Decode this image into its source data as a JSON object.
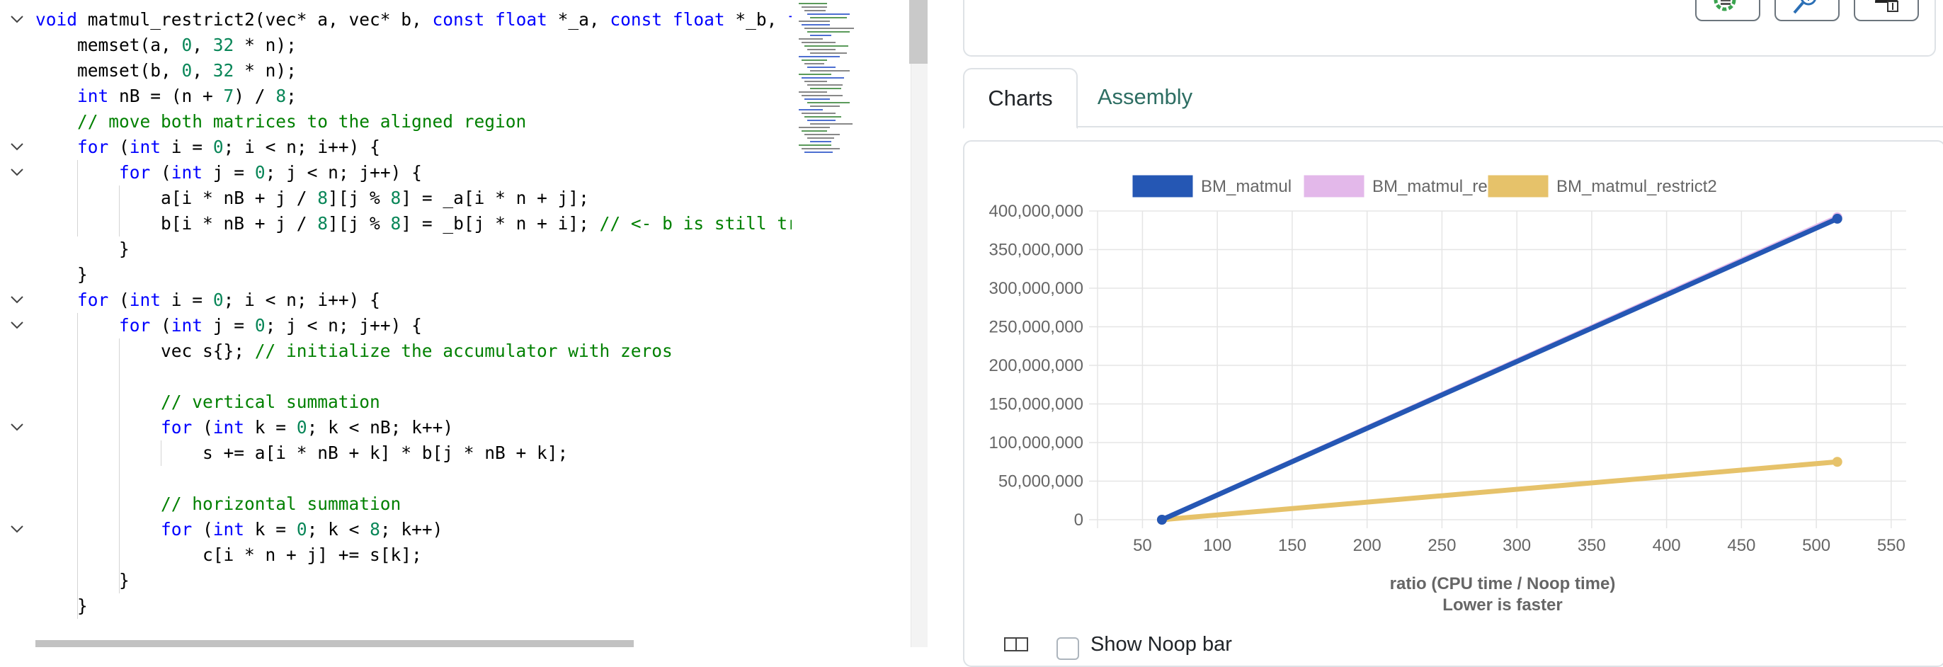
{
  "editor": {
    "code": [
      {
        "fold": true,
        "indent": 0,
        "tokens": [
          [
            "kw",
            "void"
          ],
          [
            "t",
            " matmul_restrict2(vec* a, vec* b, "
          ],
          [
            "kw",
            "const"
          ],
          [
            "t",
            " "
          ],
          [
            "kw",
            "float"
          ],
          [
            "t",
            " *_a, "
          ],
          [
            "kw",
            "const"
          ],
          [
            "t",
            " "
          ],
          [
            "kw",
            "float"
          ],
          [
            "t",
            " *_b, "
          ],
          [
            "kw",
            "fl"
          ]
        ]
      },
      {
        "fold": false,
        "indent": 1,
        "tokens": [
          [
            "t",
            "memset(a, "
          ],
          [
            "num",
            "0"
          ],
          [
            "t",
            ", "
          ],
          [
            "num",
            "32"
          ],
          [
            "t",
            " * n);"
          ]
        ]
      },
      {
        "fold": false,
        "indent": 1,
        "tokens": [
          [
            "t",
            "memset(b, "
          ],
          [
            "num",
            "0"
          ],
          [
            "t",
            ", "
          ],
          [
            "num",
            "32"
          ],
          [
            "t",
            " * n);"
          ]
        ]
      },
      {
        "fold": false,
        "indent": 1,
        "tokens": [
          [
            "kw",
            "int"
          ],
          [
            "t",
            " nB = (n + "
          ],
          [
            "num",
            "7"
          ],
          [
            "t",
            ") / "
          ],
          [
            "num",
            "8"
          ],
          [
            "t",
            ";"
          ]
        ]
      },
      {
        "fold": false,
        "indent": 1,
        "tokens": [
          [
            "cm",
            "// move both matrices to the aligned region"
          ]
        ]
      },
      {
        "fold": true,
        "indent": 1,
        "tokens": [
          [
            "kw",
            "for"
          ],
          [
            "t",
            " ("
          ],
          [
            "kw",
            "int"
          ],
          [
            "t",
            " i = "
          ],
          [
            "num",
            "0"
          ],
          [
            "t",
            "; i < n; i++) {"
          ]
        ]
      },
      {
        "fold": true,
        "indent": 2,
        "tokens": [
          [
            "kw",
            "for"
          ],
          [
            "t",
            " ("
          ],
          [
            "kw",
            "int"
          ],
          [
            "t",
            " j = "
          ],
          [
            "num",
            "0"
          ],
          [
            "t",
            "; j < n; j++) {"
          ]
        ]
      },
      {
        "fold": false,
        "indent": 3,
        "tokens": [
          [
            "t",
            "a[i * nB + j / "
          ],
          [
            "num",
            "8"
          ],
          [
            "t",
            "][j % "
          ],
          [
            "num",
            "8"
          ],
          [
            "t",
            "] = _a[i * n + j];"
          ]
        ]
      },
      {
        "fold": false,
        "indent": 3,
        "tokens": [
          [
            "t",
            "b[i * nB + j / "
          ],
          [
            "num",
            "8"
          ],
          [
            "t",
            "][j % "
          ],
          [
            "num",
            "8"
          ],
          [
            "t",
            "] = _b[j * n + i]; "
          ],
          [
            "cm",
            "// <- b is still tra"
          ]
        ]
      },
      {
        "fold": false,
        "indent": 2,
        "tokens": [
          [
            "t",
            "}"
          ]
        ]
      },
      {
        "fold": false,
        "indent": 1,
        "tokens": [
          [
            "t",
            "}"
          ]
        ]
      },
      {
        "fold": true,
        "indent": 1,
        "tokens": [
          [
            "kw",
            "for"
          ],
          [
            "t",
            " ("
          ],
          [
            "kw",
            "int"
          ],
          [
            "t",
            " i = "
          ],
          [
            "num",
            "0"
          ],
          [
            "t",
            "; i < n; i++) {"
          ]
        ]
      },
      {
        "fold": true,
        "indent": 2,
        "tokens": [
          [
            "kw",
            "for"
          ],
          [
            "t",
            " ("
          ],
          [
            "kw",
            "int"
          ],
          [
            "t",
            " j = "
          ],
          [
            "num",
            "0"
          ],
          [
            "t",
            "; j < n; j++) {"
          ]
        ]
      },
      {
        "fold": false,
        "indent": 3,
        "tokens": [
          [
            "t",
            "vec s{}; "
          ],
          [
            "cm",
            "// initialize the accumulator with zeros"
          ]
        ]
      },
      {
        "fold": false,
        "indent": 3,
        "tokens": [
          [
            "t",
            ""
          ]
        ]
      },
      {
        "fold": false,
        "indent": 3,
        "tokens": [
          [
            "cm",
            "// vertical summation"
          ]
        ]
      },
      {
        "fold": true,
        "indent": 3,
        "tokens": [
          [
            "kw",
            "for"
          ],
          [
            "t",
            " ("
          ],
          [
            "kw",
            "int"
          ],
          [
            "t",
            " k = "
          ],
          [
            "num",
            "0"
          ],
          [
            "t",
            "; k < nB; k++)"
          ]
        ]
      },
      {
        "fold": false,
        "indent": 4,
        "tokens": [
          [
            "t",
            "s += a[i * nB + k] * b[j * nB + k];"
          ]
        ]
      },
      {
        "fold": false,
        "indent": 4,
        "tokens": [
          [
            "t",
            ""
          ]
        ]
      },
      {
        "fold": false,
        "indent": 3,
        "tokens": [
          [
            "cm",
            "// horizontal summation"
          ]
        ]
      },
      {
        "fold": true,
        "indent": 3,
        "tokens": [
          [
            "kw",
            "for"
          ],
          [
            "t",
            " ("
          ],
          [
            "kw",
            "int"
          ],
          [
            "t",
            " k = "
          ],
          [
            "num",
            "0"
          ],
          [
            "t",
            "; k < "
          ],
          [
            "num",
            "8"
          ],
          [
            "t",
            "; k++)"
          ]
        ]
      },
      {
        "fold": false,
        "indent": 4,
        "tokens": [
          [
            "t",
            "c[i * n + j] += s[k];"
          ]
        ]
      },
      {
        "fold": false,
        "indent": 2,
        "tokens": [
          [
            "t",
            "}"
          ]
        ]
      },
      {
        "fold": false,
        "indent": 1,
        "tokens": [
          [
            "t",
            "}"
          ]
        ]
      }
    ]
  },
  "toolbar": {
    "buttons": [
      {
        "icon": "gear-list-icon"
      },
      {
        "icon": "zoom-icon"
      },
      {
        "icon": "cloud-upload-icon"
      }
    ]
  },
  "tabs": [
    {
      "label": "Charts",
      "active": true
    },
    {
      "label": "Assembly",
      "active": false
    }
  ],
  "chart_data": {
    "type": "line",
    "xlabel": "ratio (CPU time / Noop time)",
    "xlabel_sub": "Lower is faster",
    "ylabel": "",
    "xlim": [
      20,
      560
    ],
    "ylim": [
      0,
      400000000
    ],
    "xticks": [
      50,
      100,
      150,
      200,
      250,
      300,
      350,
      400,
      450,
      500,
      550
    ],
    "yticks": [
      0,
      50000000,
      100000000,
      150000000,
      200000000,
      250000000,
      300000000,
      350000000,
      400000000
    ],
    "ytick_labels": [
      "0",
      "50,000,000",
      "100,000,000",
      "150,000,000",
      "200,000,000",
      "250,000,000",
      "300,000,000",
      "350,000,000",
      "400,000,000"
    ],
    "xtick_labels": [
      "50",
      "100",
      "150",
      "200",
      "250",
      "300",
      "350",
      "400",
      "450",
      "500",
      "550"
    ],
    "grid": true,
    "legend_position": "top",
    "series": [
      {
        "name": "BM_matmul",
        "color": "#2557b4",
        "points": [
          [
            63,
            0
          ],
          [
            514,
            390000000
          ]
        ]
      },
      {
        "name": "BM_matmul_restrict",
        "color": "#e3b8ea",
        "points": [
          [
            63,
            0
          ],
          [
            514,
            392000000
          ]
        ]
      },
      {
        "name": "BM_matmul_restrict2",
        "color": "#e6c26a",
        "points": [
          [
            63,
            0
          ],
          [
            514,
            75000000
          ]
        ]
      }
    ]
  },
  "bottom": {
    "noop_label": "Show Noop bar"
  }
}
